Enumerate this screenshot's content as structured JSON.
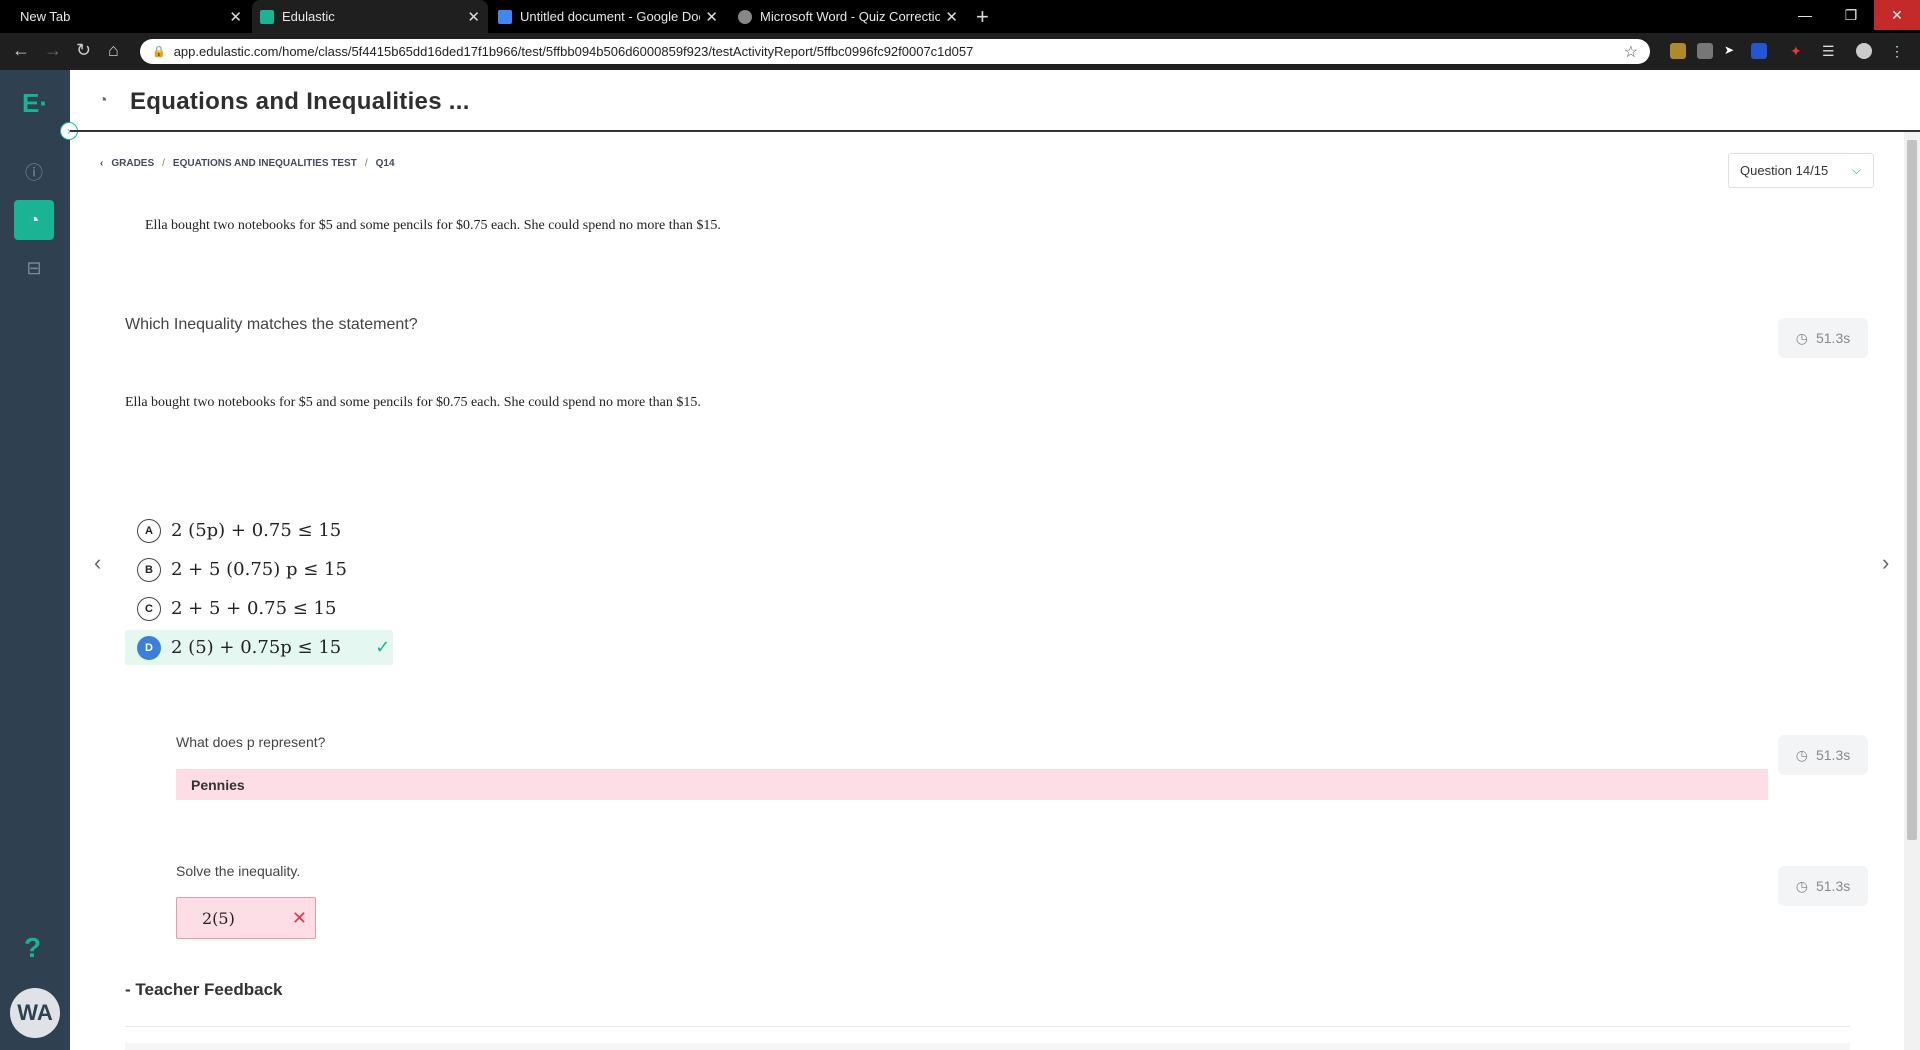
{
  "browser": {
    "tabs": [
      {
        "title": "New Tab",
        "close": "✕",
        "favicon_color": "",
        "active": false
      },
      {
        "title": "Edulastic",
        "close": "✕",
        "favicon_color": "#1ab394",
        "active": true
      },
      {
        "title": "Untitled document - Google Doc",
        "close": "✕",
        "favicon_color": "#4285f4",
        "active": false
      },
      {
        "title": "Microsoft Word - Quiz Correctio",
        "close": "✕",
        "favicon_color": "#888888",
        "active": false
      }
    ],
    "new_tab": "+",
    "url": "app.edulastic.com/home/class/5f4415b65dd16ded17f1b966/test/5ffbb094b506d6000859f923/testActivityReport/5ffbc0996fc92f0007c1d057",
    "window_controls": {
      "minimize": "—",
      "restore": "❐",
      "close": "✕"
    }
  },
  "app": {
    "logo": "E·",
    "avatar_initials": "WA",
    "help": "?",
    "title": "Equations and Inequalities ...",
    "breadcrumb": [
      "GRADES",
      "EQUATIONS AND INEQUALITIES TEST",
      "Q14"
    ],
    "breadcrumb_sep": "/",
    "question_select": "Question 14/15",
    "stimulus": "Ella bought two notebooks for $5 and some pencils for $0.75 each. She could spend no more than $15.",
    "question": "Which Inequality matches the statement?",
    "question_stimulus": "Ella bought two notebooks for $5 and some pencils for $0.75 each. She could spend no more than $15.",
    "timers": [
      "51.3s",
      "51.3s",
      "51.3s"
    ],
    "options": [
      {
        "label": "A",
        "text": "2 (5p) + 0.75 ≤ 15",
        "correct": false
      },
      {
        "label": "B",
        "text": "2 + 5 (0.75) p ≤ 15",
        "correct": false
      },
      {
        "label": "C",
        "text": "2 + 5 + 0.75 ≤ 15",
        "correct": false
      },
      {
        "label": "D",
        "text": "2 (5) + 0.75p ≤ 15",
        "correct": true
      }
    ],
    "sub_question_1": "What does p represent?",
    "sub_answer_1": "Pennies",
    "sub_question_2": "Solve the inequality.",
    "sub_answer_2": "2(5)",
    "feedback_title": "- Teacher Feedback"
  },
  "colors": {
    "accent": "#1ab394",
    "sidebar": "#2f4151",
    "correct_bg": "#e5f7f1",
    "incorrect_bg": "#fddde6",
    "selected_option": "#3a80d9"
  }
}
